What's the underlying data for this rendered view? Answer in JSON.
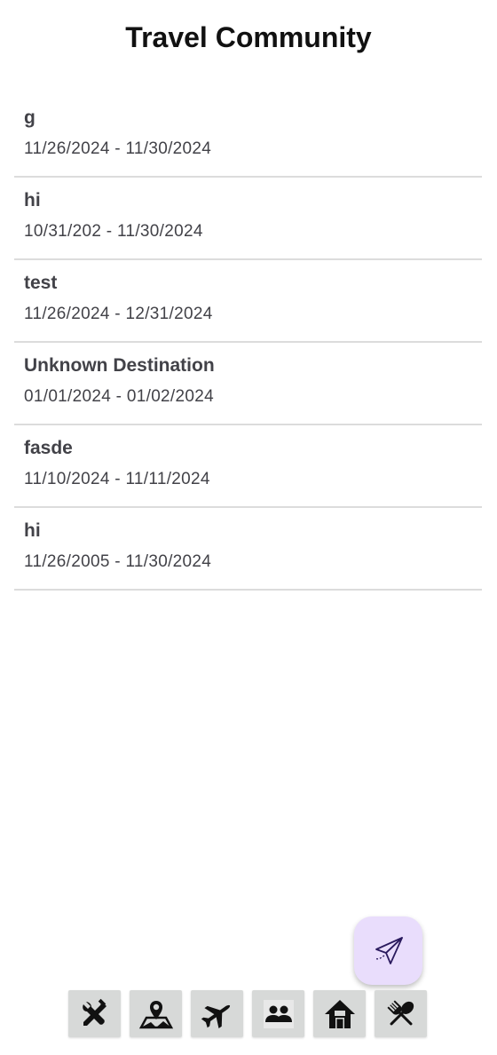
{
  "header": {
    "title": "Travel Community"
  },
  "trips": [
    {
      "name": "g",
      "dates": "11/26/2024 - 11/30/2024"
    },
    {
      "name": "hi",
      "dates": "10/31/202 - 11/30/2024"
    },
    {
      "name": "test",
      "dates": "11/26/2024 - 12/31/2024"
    },
    {
      "name": "Unknown Destination",
      "dates": "01/01/2024 - 01/02/2024"
    },
    {
      "name": "fasde",
      "dates": "11/10/2024 - 11/11/2024"
    },
    {
      "name": "hi",
      "dates": "11/26/2005 - 11/30/2024"
    }
  ],
  "fab": {
    "icon": "paper-plane-icon",
    "color": "#e9ddfc"
  },
  "bottom_nav": [
    {
      "icon": "tools-icon"
    },
    {
      "icon": "map-pin-icon"
    },
    {
      "icon": "airplane-icon"
    },
    {
      "icon": "people-icon"
    },
    {
      "icon": "home-icon"
    },
    {
      "icon": "fork-spoon-icon"
    }
  ],
  "colors": {
    "text": "#424248",
    "divider": "#dcdcdc",
    "nav_button": "#d7d9d8"
  }
}
